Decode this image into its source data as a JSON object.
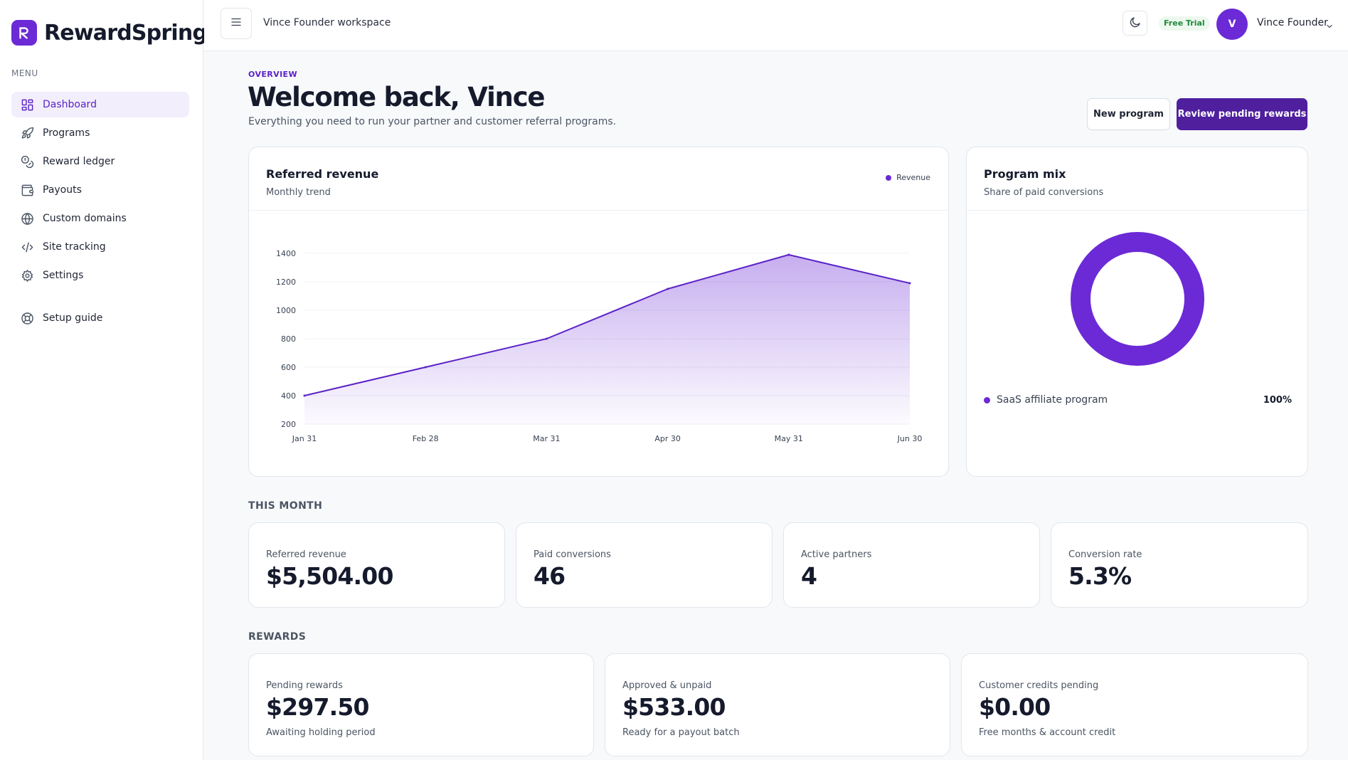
{
  "app": {
    "brand_name": "RewardSpring",
    "menu_label": "MENU",
    "accent_color": "#6b2ad6"
  },
  "sidebar": {
    "items": [
      {
        "label": "Dashboard",
        "icon": "dashboard-icon"
      },
      {
        "label": "Programs",
        "icon": "rocket-icon"
      },
      {
        "label": "Reward ledger",
        "icon": "coins-icon"
      },
      {
        "label": "Payouts",
        "icon": "wallet-icon"
      },
      {
        "label": "Custom domains",
        "icon": "globe-icon"
      },
      {
        "label": "Site tracking",
        "icon": "code-icon"
      },
      {
        "label": "Settings",
        "icon": "gear-icon"
      },
      {
        "label": "Setup guide",
        "icon": "lifebuoy-icon"
      }
    ]
  },
  "topbar": {
    "workspace": "Vince Founder workspace",
    "trial_badge": "Free Trial",
    "avatar_initial": "V",
    "user_name": "Vince Founder"
  },
  "header": {
    "eyebrow": "OVERVIEW",
    "title": "Welcome back, Vince",
    "subtitle": "Everything you need to run your partner and customer referral programs.",
    "new_program_label": "New program",
    "review_label": "Review pending rewards"
  },
  "revenue_card": {
    "title": "Referred revenue",
    "subtitle": "Monthly trend",
    "legend": "Revenue"
  },
  "mix_card": {
    "title": "Program mix",
    "subtitle": "Share of paid conversions",
    "items": [
      {
        "name": "SaaS affiliate program",
        "value_label": "100%",
        "share": 1.0
      }
    ]
  },
  "this_month": {
    "label": "THIS MONTH",
    "stats": [
      {
        "label": "Referred revenue",
        "value": "$5,504.00"
      },
      {
        "label": "Paid conversions",
        "value": "46"
      },
      {
        "label": "Active partners",
        "value": "4"
      },
      {
        "label": "Conversion rate",
        "value": "5.3%"
      }
    ]
  },
  "rewards": {
    "label": "REWARDS",
    "stats": [
      {
        "label": "Pending rewards",
        "value": "$297.50",
        "note": "Awaiting holding period"
      },
      {
        "label": "Approved & unpaid",
        "value": "$533.00",
        "note": "Ready for a payout batch"
      },
      {
        "label": "Customer credits pending",
        "value": "$0.00",
        "note": "Free months & account credit"
      }
    ]
  },
  "chart_data": [
    {
      "type": "area",
      "x": [
        "Jan 31",
        "Feb 28",
        "Mar 31",
        "Apr 30",
        "May 31",
        "Jun 30"
      ],
      "series": [
        {
          "name": "Revenue",
          "values": [
            400,
            600,
            800,
            1150,
            1390,
            1190
          ]
        }
      ],
      "yticks": [
        200,
        400,
        600,
        800,
        1000,
        1200,
        1400
      ],
      "ylim": [
        200,
        1400
      ],
      "grid": true,
      "legend": "top-right"
    },
    {
      "type": "pie",
      "categories": [
        "SaaS affiliate program"
      ],
      "values": [
        100
      ]
    }
  ]
}
